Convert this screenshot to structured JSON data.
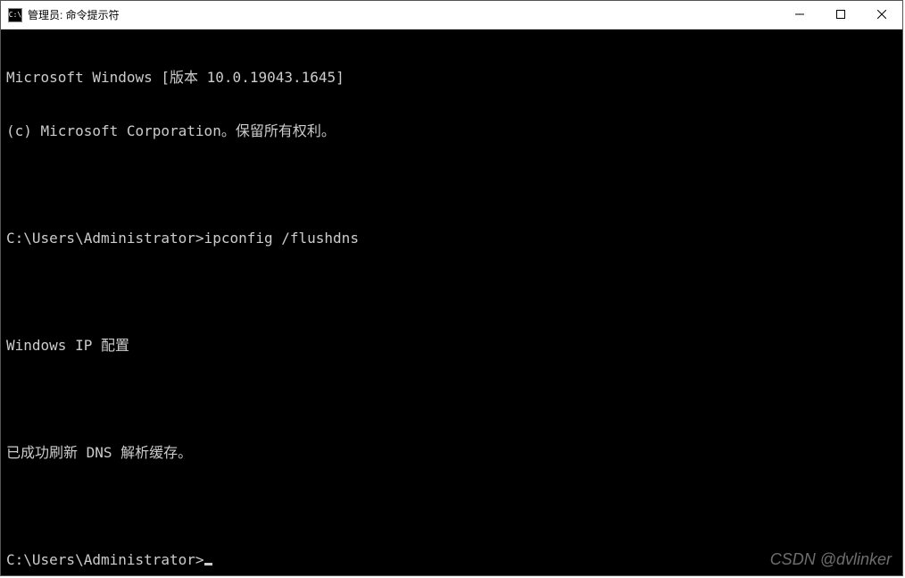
{
  "titlebar": {
    "icon_label": "C:\\",
    "title": "管理员: 命令提示符"
  },
  "terminal": {
    "lines": [
      "Microsoft Windows [版本 10.0.19043.1645]",
      "(c) Microsoft Corporation。保留所有权利。",
      "",
      "C:\\Users\\Administrator>ipconfig /flushdns",
      "",
      "Windows IP 配置",
      "",
      "已成功刷新 DNS 解析缓存。",
      ""
    ],
    "prompt": "C:\\Users\\Administrator>"
  },
  "watermark": "CSDN @dvlinker"
}
